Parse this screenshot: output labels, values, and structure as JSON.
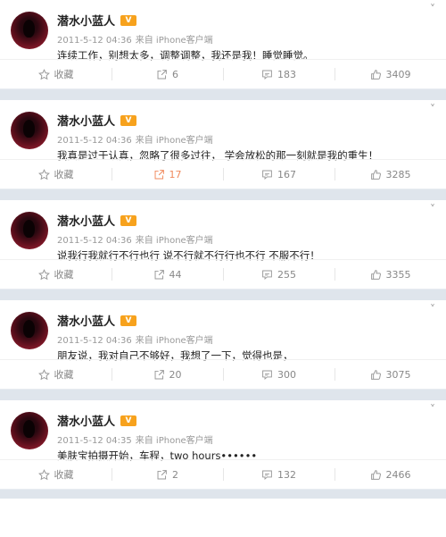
{
  "ui": {
    "more_glyph": "˅",
    "vip_label": "V",
    "favorite_label": "收藏"
  },
  "posts": [
    {
      "author": "潜水小蓝人",
      "date": "2011-5-12 04:36",
      "source": "来自 iPhone客户端",
      "content": "连续工作，别想太多，调整调整，我还是我！睡觉睡觉。",
      "reposts": "6",
      "comments": "183",
      "likes": "3409"
    },
    {
      "author": "潜水小蓝人",
      "date": "2011-5-12 04:36",
      "source": "来自 iPhone客户端",
      "content": "我真是过于认真，忽略了很多过往， 学会放松的那一刻就是我的重生！",
      "reposts": "17",
      "comments": "167",
      "likes": "3285"
    },
    {
      "author": "潜水小蓝人",
      "date": "2011-5-12 04:36",
      "source": "来自 iPhone客户端",
      "content": "说我行我就行不行也行 说不行就不行行也不行 不服不行！",
      "reposts": "44",
      "comments": "255",
      "likes": "3355"
    },
    {
      "author": "潜水小蓝人",
      "date": "2011-5-12 04:36",
      "source": "来自 iPhone客户端",
      "content": "朋友说，我对自己不够好，我想了一下，觉得也是，",
      "reposts": "20",
      "comments": "300",
      "likes": "3075"
    },
    {
      "author": "潜水小蓝人",
      "date": "2011-5-12 04:35",
      "source": "来自 iPhone客户端",
      "content": "美肤宝拍摄开始，车程，two hours••••••",
      "reposts": "2",
      "comments": "132",
      "likes": "2466"
    }
  ]
}
